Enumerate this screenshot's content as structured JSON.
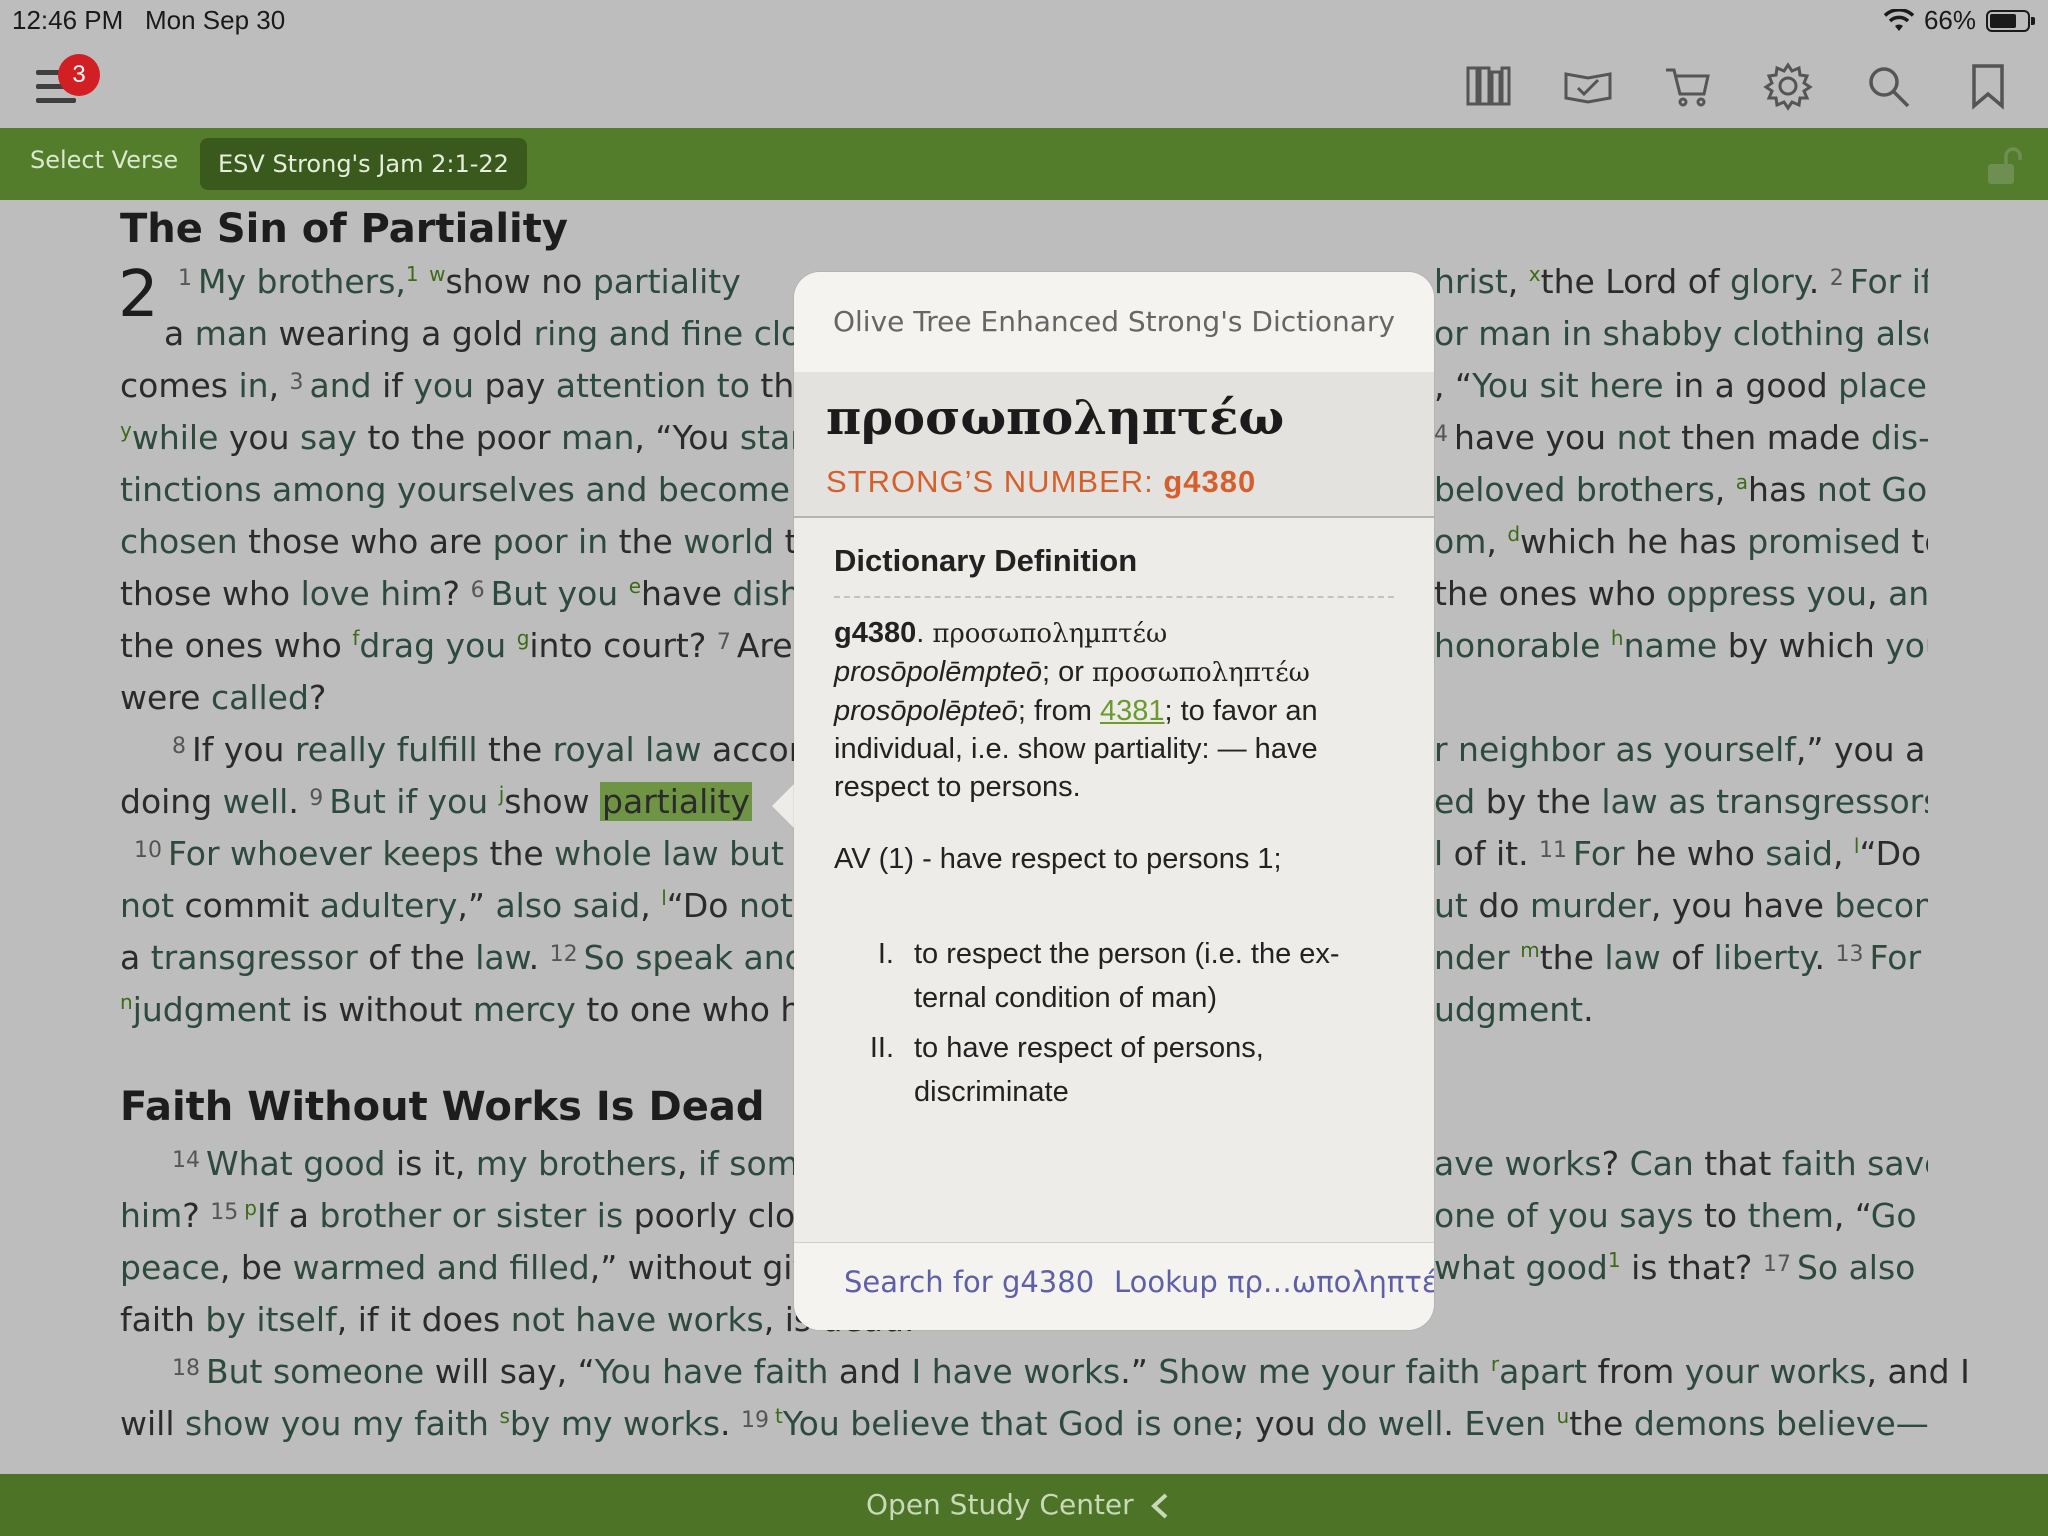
{
  "status": {
    "time": "12:46 PM",
    "date": "Mon Sep 30",
    "battery": "66%"
  },
  "toolbar": {
    "badge": "3"
  },
  "nav": {
    "select_verse": "Select Verse",
    "reference": "ESV Strong's Jam 2:1-22"
  },
  "text": {
    "heading1": "The Sin of Partiality",
    "chapter": "2",
    "heading2": "Faith Without Works Is Dead"
  },
  "popup": {
    "title": "Olive Tree Enhanced Strong's Dictionary",
    "headword": "προσωποληπτέω",
    "strongs_label": "STRONG’S NUMBER: ",
    "strongs_number": "g4380",
    "section": "Dictionary Definition",
    "def_id": "g4380",
    "def_greek1": "προσωποληµπτέω",
    "def_translit1": "prosōpolēmpteō",
    "def_or": "; or ",
    "def_greek2": "προσωποληπτέω",
    "def_translit2": "prosōpolēpteō",
    "def_from": "; from ",
    "def_link": "4381",
    "def_rest": "; to favor an individual, i.e. show partiality: — have respect to persons.",
    "av": "AV (1) - have respect to persons 1;",
    "items": [
      {
        "num": "I.",
        "text": "to respect the person (i.e. the ex-ternal condition of man)"
      },
      {
        "num": "II.",
        "text": "to have respect of persons, discriminate"
      }
    ],
    "search_button": "Search for g4380",
    "lookup_button": "Lookup πρ…ωποληπτέω"
  },
  "bottom": {
    "label": "Open Study Center"
  },
  "colors": {
    "nav_green": "#537d2a",
    "accent_orange": "#d4612d",
    "link_green": "#6b9a2e",
    "button_purple": "#5f5fa8"
  }
}
